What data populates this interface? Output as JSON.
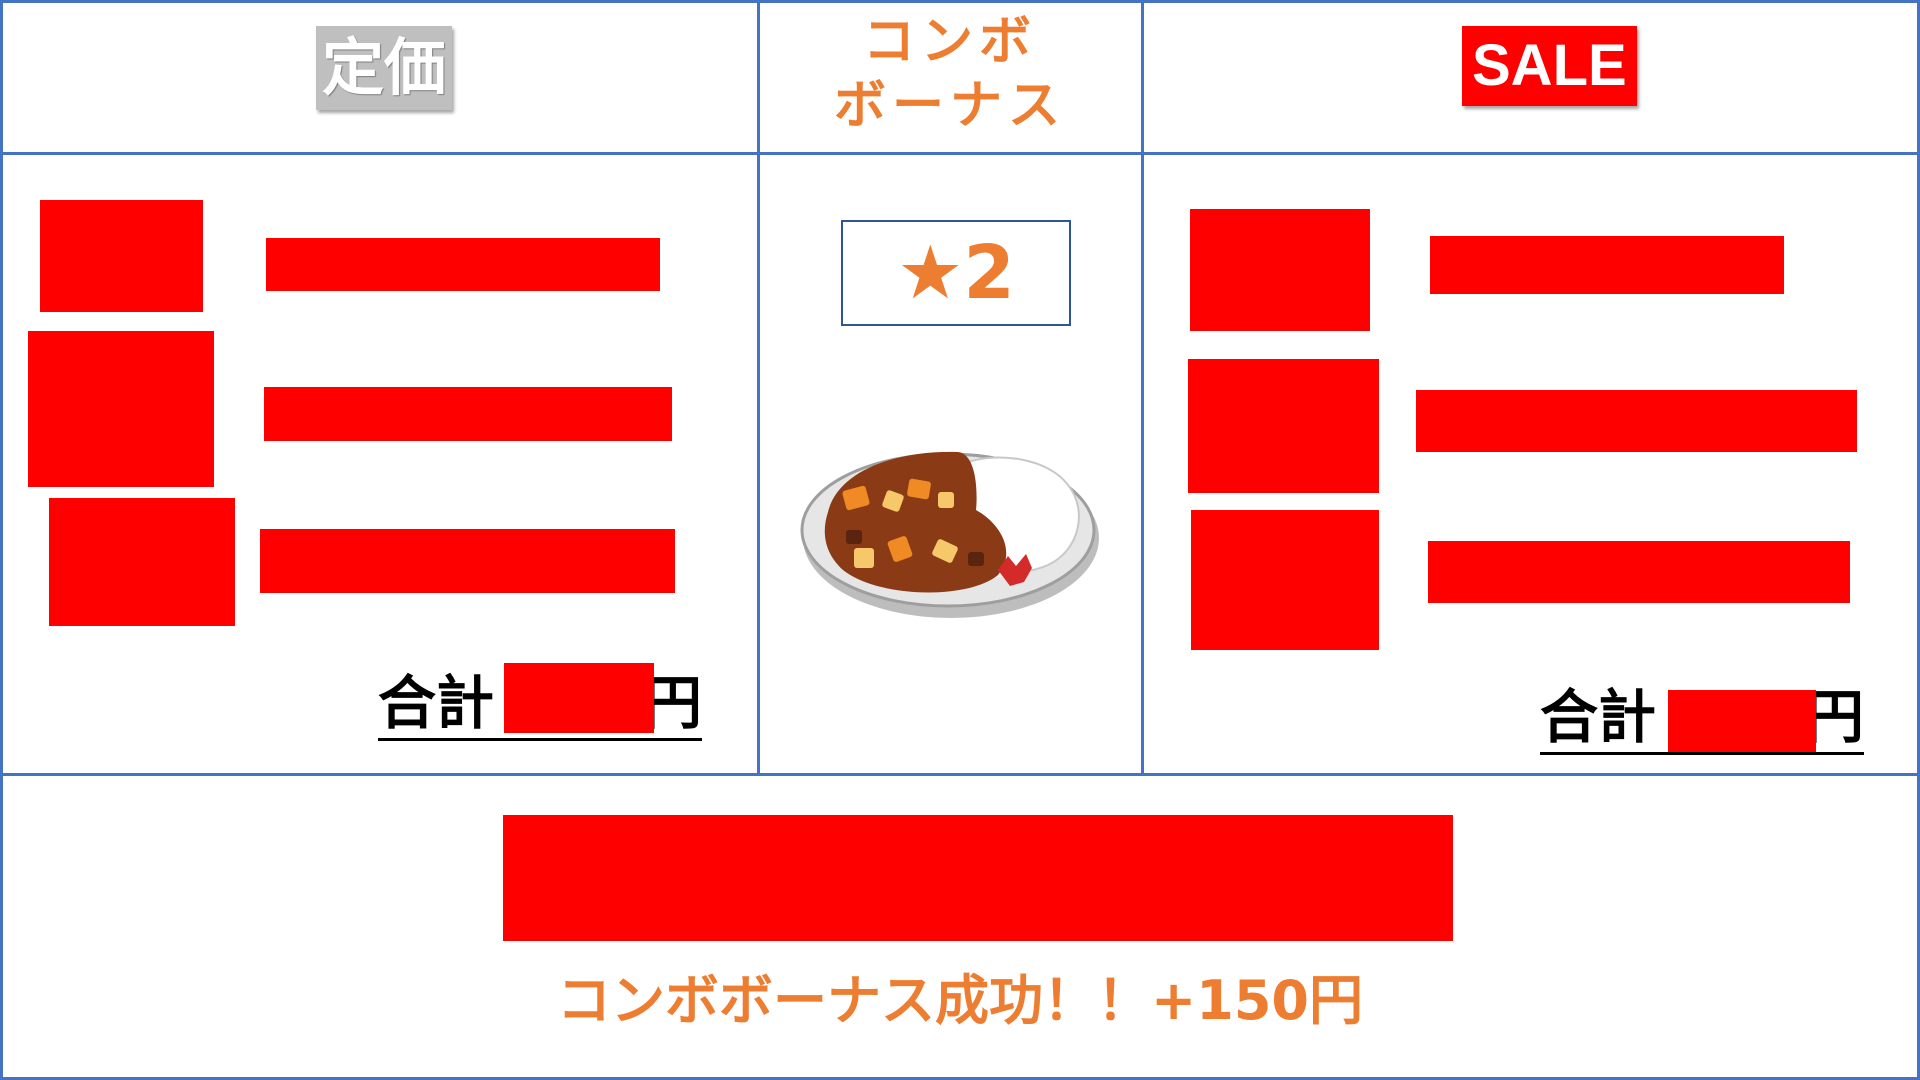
{
  "header": {
    "regular_label": "定価",
    "combo_label_line1": "コンボ",
    "combo_label_line2": "ボーナス",
    "sale_label": "SALE"
  },
  "regular_panel": {
    "total_prefix": "合計",
    "total_suffix": "円"
  },
  "combo_panel": {
    "star_glyph": "★",
    "star_count": "2",
    "dish_icon": "curry-rice-icon"
  },
  "sale_panel": {
    "total_prefix": "合計",
    "total_suffix": "円"
  },
  "footer": {
    "bonus_message": "コンボボーナス成功！！+150円"
  },
  "colors": {
    "grid_border": "#4472c4",
    "accent_orange": "#ed7d31",
    "redaction_red": "#fe0000",
    "regular_badge_gray": "#bfbfbf"
  }
}
